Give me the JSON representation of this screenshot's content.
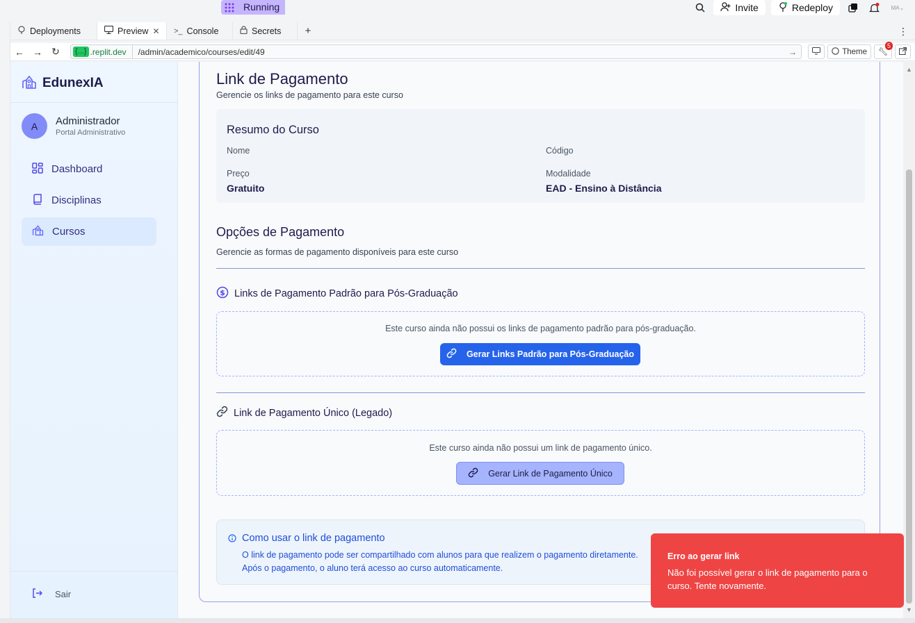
{
  "topbar": {
    "running_label": "Running",
    "invite_label": "Invite",
    "redeploy_label": "Redeploy",
    "avatar_initials": "MA"
  },
  "tabs": [
    {
      "label": "Deployments"
    },
    {
      "label": "Preview"
    },
    {
      "label": "Console"
    },
    {
      "label": "Secrets"
    }
  ],
  "address": {
    "host_pill": "{...}",
    "host": ".replit.dev",
    "path": "/admin/academico/courses/edit/49",
    "theme_label": "Theme",
    "badge_count": "5"
  },
  "sidebar": {
    "brand": "EdunexIA",
    "user_initial": "A",
    "user_name": "Administrador",
    "user_role": "Portal Administrativo",
    "items": [
      {
        "label": "Dashboard"
      },
      {
        "label": "Disciplinas"
      },
      {
        "label": "Cursos"
      }
    ],
    "logout": "Sair"
  },
  "main": {
    "title": "Link de Pagamento",
    "subtitle": "Gerencie os links de pagamento para este curso",
    "resumo": {
      "title": "Resumo do Curso",
      "nome_label": "Nome",
      "nome_value": "",
      "codigo_label": "Código",
      "codigo_value": "",
      "preco_label": "Preço",
      "preco_value": "Gratuito",
      "modalidade_label": "Modalidade",
      "modalidade_value": "EAD - Ensino à Distância"
    },
    "opcoes_title": "Opções de Pagamento",
    "opcoes_subtitle": "Gerencie as formas de pagamento disponíveis para este curso",
    "padrao": {
      "title": "Links de Pagamento Padrão para Pós-Graduação",
      "message": "Este curso ainda não possui os links de pagamento padrão para pós-graduação.",
      "button": "Gerar Links Padrão para Pós-Graduação"
    },
    "unico": {
      "title": "Link de Pagamento Único (Legado)",
      "message": "Este curso ainda não possui um link de pagamento único.",
      "button": "Gerar Link de Pagamento Único"
    },
    "info": {
      "title": "Como usar o link de pagamento",
      "line1": "O link de pagamento pode ser compartilhado com alunos para que realizem o pagamento diretamente.",
      "line2": "Após o pagamento, o aluno terá acesso ao curso automaticamente."
    }
  },
  "toast": {
    "title": "Erro ao gerar link",
    "description": "Não foi possível gerar o link de pagamento para o curso. Tente novamente."
  },
  "colors": {
    "accent": "#2563eb",
    "error": "#ef4444",
    "soft_button": "#a5b4fc"
  }
}
